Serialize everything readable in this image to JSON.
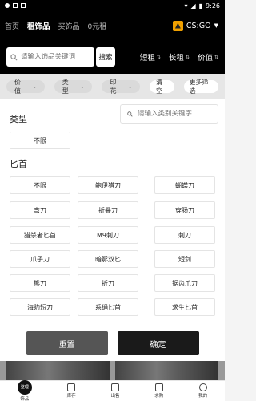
{
  "status_bar": {
    "time": "9:26"
  },
  "top_nav": {
    "items": [
      "首页",
      "租饰品",
      "买饰品",
      "0元租"
    ],
    "active_index": 1,
    "game": "CS:GO"
  },
  "search": {
    "placeholder": "请输入饰品关键词",
    "button_label": "搜索"
  },
  "sort": {
    "items": [
      "短租",
      "长租",
      "价值"
    ]
  },
  "chips": {
    "items": [
      "价值",
      "类型",
      "印花"
    ],
    "clear_label": "清空",
    "more_label": "更多筛选"
  },
  "panel": {
    "type_heading": "类型",
    "type_search_placeholder": "请输入类别关键字",
    "type_options": [
      "不限"
    ],
    "section_heading": "匕首",
    "dagger_options": [
      "不限",
      "鲍伊猎刀",
      "蝴蝶刀",
      "弯刀",
      "折叠刀",
      "穿肠刀",
      "猎杀者匕首",
      "M9刺刀",
      "刺刀",
      "爪子刀",
      "暗影双匕",
      "短剑",
      "熊刀",
      "折刀",
      "锯齿爪刀",
      "海豹短刀",
      "系绳匕首",
      "求生匕首"
    ],
    "reset_label": "重置",
    "confirm_label": "确定"
  },
  "tab_bar": {
    "items": [
      "饰品",
      "库存",
      "出售",
      "求购",
      "我的"
    ],
    "home_label_line1": "整理",
    "home_label_line2": "饰品"
  },
  "colors": {
    "header_bg": "#000000",
    "accent_logo": "#f0a000",
    "confirm_bg": "#1a1a1a",
    "reset_bg": "#555555"
  }
}
